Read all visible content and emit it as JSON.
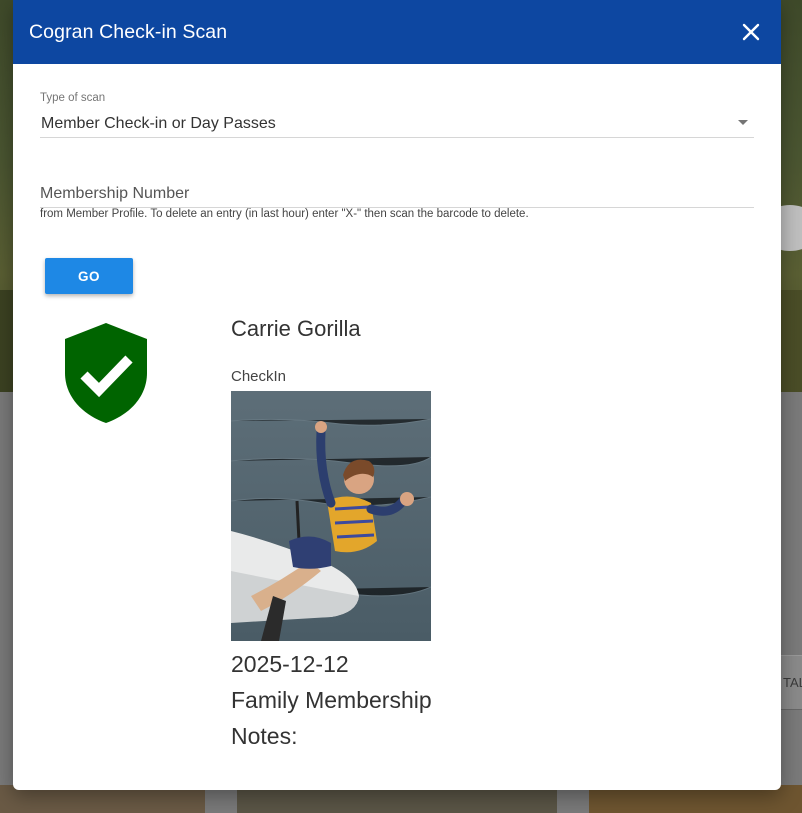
{
  "modal": {
    "title": "Cogran Check-in Scan",
    "close_icon": "close-icon"
  },
  "scan_type": {
    "label": "Type of scan",
    "value": "Member Check-in or Day Passes"
  },
  "membership_number": {
    "placeholder": "Membership Number",
    "value": "",
    "hint": "from Member Profile. To delete an entry (in last hour) enter \"X-\" then scan the barcode to delete."
  },
  "go_button": {
    "label": "GO"
  },
  "result": {
    "status_icon": "shield-check-icon",
    "status_color": "#006400",
    "name": "Carrie Gorilla",
    "type_label": "CheckIn",
    "photo": "member-photo",
    "date": "2025-12-12",
    "membership": "Family Membership",
    "notes_label": "Notes:"
  },
  "background": {
    "tab_text": "TAL"
  },
  "colors": {
    "header": "#0d47a1",
    "button": "#1e88e5"
  }
}
